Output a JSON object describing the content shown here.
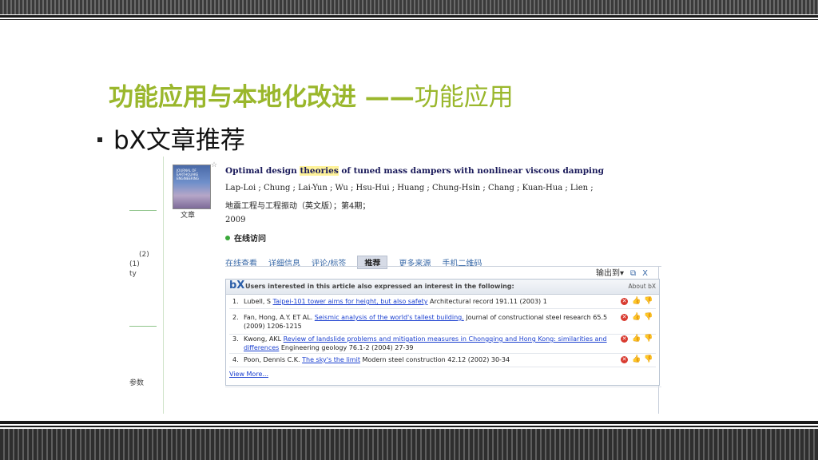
{
  "slide": {
    "title_bold": "功能应用与本地化改进 ——",
    "title_normal": "功能应用",
    "bullet": "bX文章推荐"
  },
  "left_fragments": {
    "count_a": "(2)",
    "count_b": "(1)",
    "word": "ty",
    "param": "参数"
  },
  "article": {
    "cover_label": "文章",
    "cover_text": "JOURNAL OF EARTHQUAKE ENGINEERING",
    "title_before": "Optimal design ",
    "title_highlight": "theories",
    "title_after": " of tuned mass dampers with nonlinear viscous damping",
    "authors": "Lap-Loi ; Chung ; Lai-Yun ; Wu ; Hsu-Hui ; Huang ; Chung-Hsin ; Chang ; Kuan-Hua ; Lien ;",
    "journal": "地震工程与工程振动（英文版）；第4期；",
    "year": "2009",
    "online_access": "在线访问"
  },
  "tabs": [
    {
      "label": "在线查看"
    },
    {
      "label": "详细信息"
    },
    {
      "label": "评论/标签"
    },
    {
      "label": "推荐"
    },
    {
      "label": "更多来源"
    },
    {
      "label": "手机二维码"
    }
  ],
  "output": {
    "label": "输出到",
    "arrow": "▾",
    "popout": "⧉",
    "close": "X"
  },
  "bx": {
    "logo": "bX",
    "header": "Users interested in this article also expressed an interest in the following:",
    "about": "About bX",
    "view_more": "View More...",
    "items": [
      {
        "num": "1.",
        "author": "Lubell, S ",
        "link": "Taipei-101 tower aims for height, but also safety",
        "rest": " Architectural record 191.11 (2003) 1"
      },
      {
        "num": "2.",
        "author": "Fan, Hong, A.Y. ET AL. ",
        "link": "Seismic analysis of the world's tallest building.",
        "rest": " Journal of constructional steel research 65.5 (2009) 1206-1215"
      },
      {
        "num": "3.",
        "author": "Kwong, AKL ",
        "link": "Review of landslide problems and mitigation measures in Chongqing and Hong Kong: similarities and differences",
        "rest": " Engineering geology 76.1-2 (2004) 27-39"
      },
      {
        "num": "4.",
        "author": "Poon, Dennis C.K. ",
        "link": "The sky's the limit",
        "rest": " Modern steel construction 42.12 (2002) 30-34"
      }
    ]
  },
  "colors": {
    "title_green": "#9ab72c",
    "link_blue": "#1a3fd0",
    "tab_blue": "#3a6aa8",
    "dislike_red": "#d83a2f"
  },
  "icons": {
    "bullet": "square-bullet-icon",
    "dislike": "x-circle-icon",
    "like": "thumbs-up-icon",
    "report": "thumbs-down-icon"
  }
}
